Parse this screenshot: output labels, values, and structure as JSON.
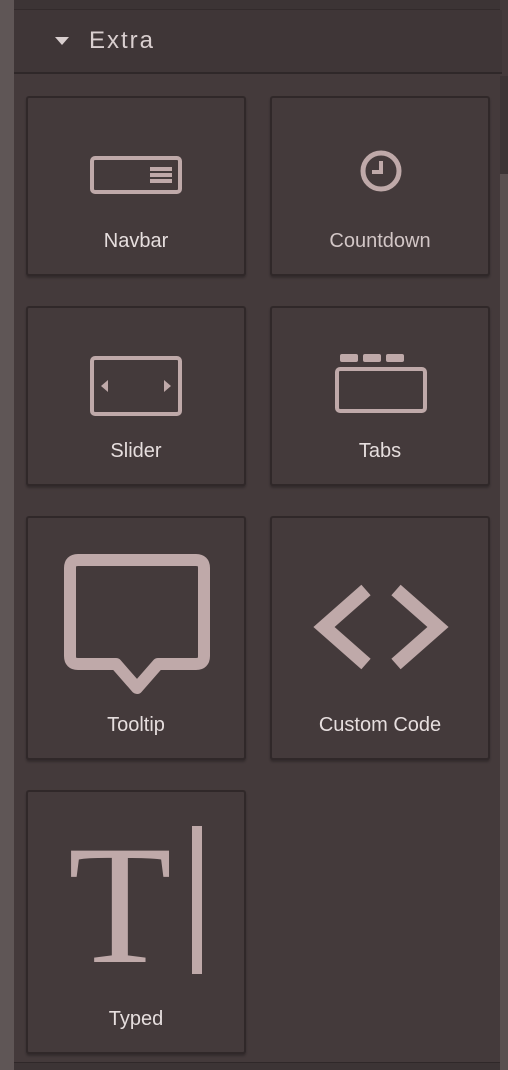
{
  "section": {
    "title": "Extra",
    "caret_icon": "caret-down-icon"
  },
  "blocks": [
    {
      "label": "Navbar",
      "icon": "navbar-icon"
    },
    {
      "label": "Countdown",
      "icon": "clock-icon"
    },
    {
      "label": "Slider",
      "icon": "slider-icon"
    },
    {
      "label": "Tabs",
      "icon": "tabs-icon"
    },
    {
      "label": "Tooltip",
      "icon": "tooltip-icon"
    },
    {
      "label": "Custom Code",
      "icon": "code-icon"
    },
    {
      "label": "Typed",
      "icon": "typed-text-icon"
    }
  ],
  "colors": {
    "panel_background": "#443a3b",
    "icon": "#bfa9a9",
    "label_text": "#e6dede",
    "border": "#302829"
  }
}
